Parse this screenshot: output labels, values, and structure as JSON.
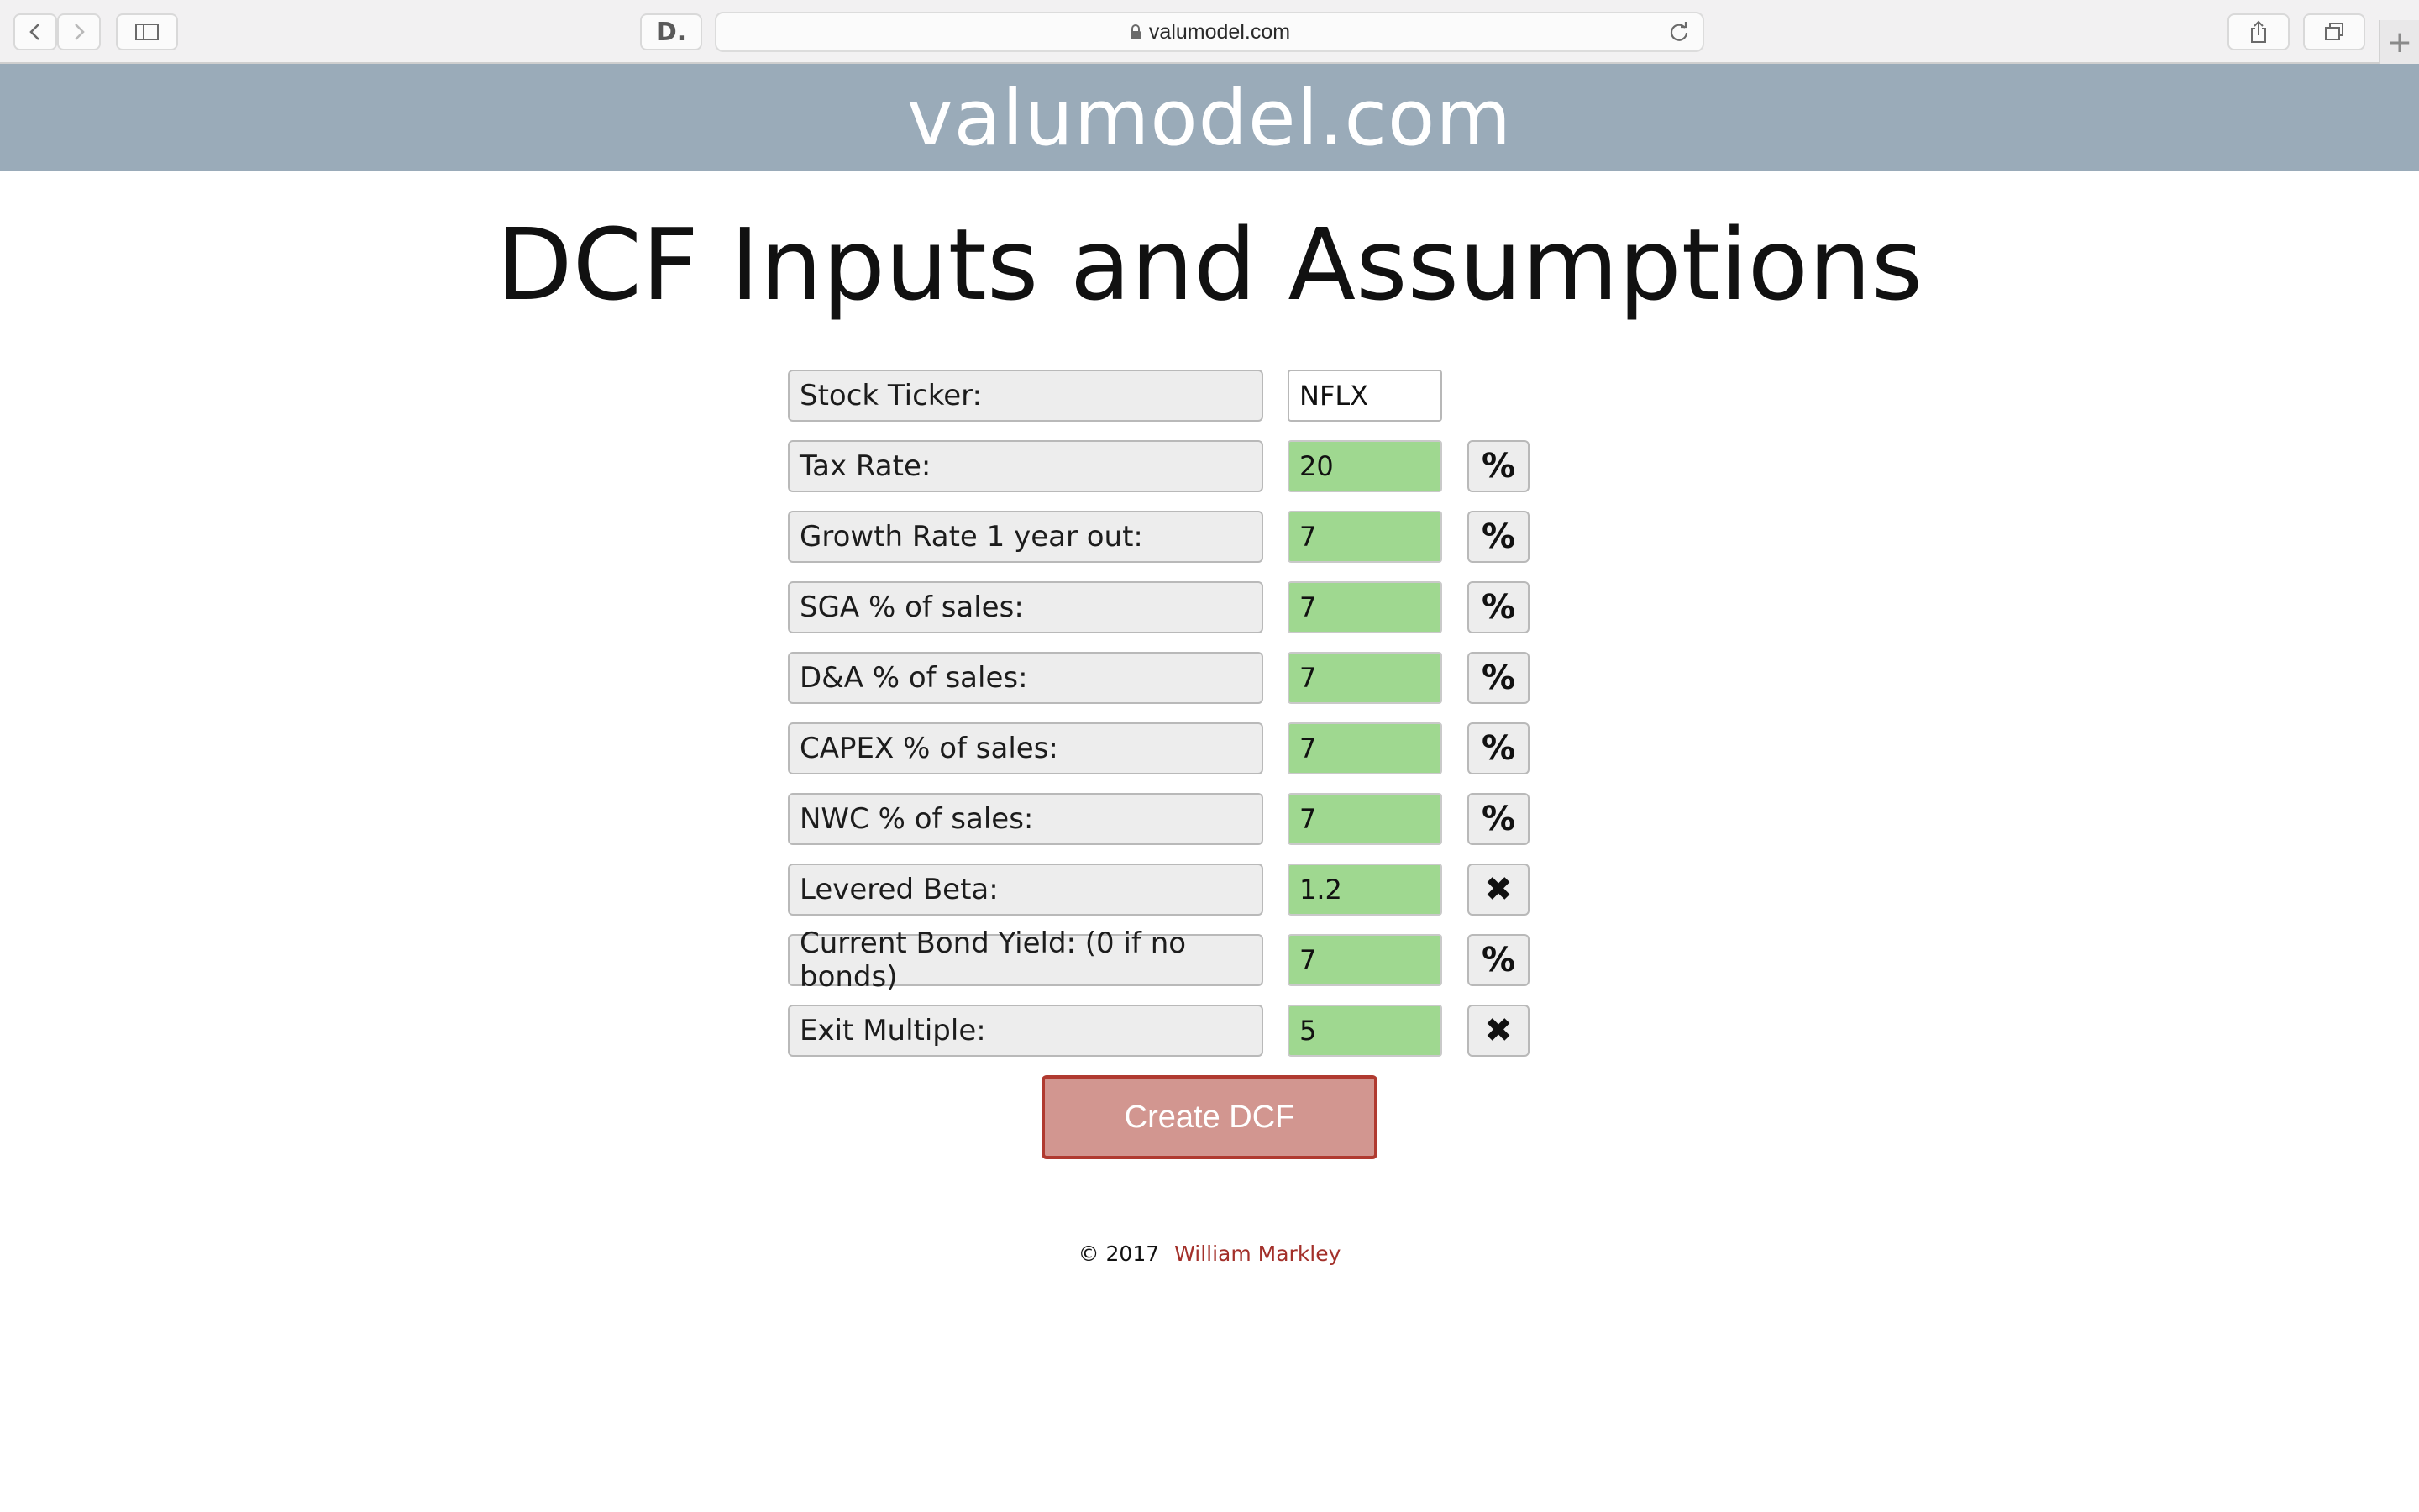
{
  "browser": {
    "url": "valumodel.com",
    "back_icon": "chevron-left-icon",
    "forward_icon": "chevron-right-icon",
    "sidebar_icon": "sidebar-icon",
    "extension_label": "D.",
    "share_icon": "share-icon",
    "tabs_icon": "tabs-icon",
    "new_tab_label": "+"
  },
  "header": {
    "site_name": "valumodel.com",
    "background_color": "#9aabb9"
  },
  "page": {
    "title": "DCF Inputs and Assumptions"
  },
  "form": {
    "rows": [
      {
        "label": "Stock Ticker:",
        "value": "NFLX",
        "unit": null
      },
      {
        "label": "Tax Rate:",
        "value": "20",
        "unit": "%"
      },
      {
        "label": "Growth Rate 1 year out:",
        "value": "7",
        "unit": "%"
      },
      {
        "label": "SGA % of sales:",
        "value": "7",
        "unit": "%"
      },
      {
        "label": "D&A % of sales:",
        "value": "7",
        "unit": "%"
      },
      {
        "label": "CAPEX % of sales:",
        "value": "7",
        "unit": "%"
      },
      {
        "label": "NWC % of sales:",
        "value": "7",
        "unit": "%"
      },
      {
        "label": "Levered Beta:",
        "value": "1.2",
        "unit": "✖"
      },
      {
        "label": "Current Bond Yield: (0 if no bonds)",
        "value": "7",
        "unit": "%"
      },
      {
        "label": "Exit Multiple:",
        "value": "5",
        "unit": "✖"
      }
    ],
    "submit_label": "Create DCF",
    "input_fill_color": "#9fd890",
    "submit_color": "#d29690"
  },
  "footer": {
    "copyright": "© 2017",
    "author": "William Markley",
    "author_color": "#a3302a"
  }
}
